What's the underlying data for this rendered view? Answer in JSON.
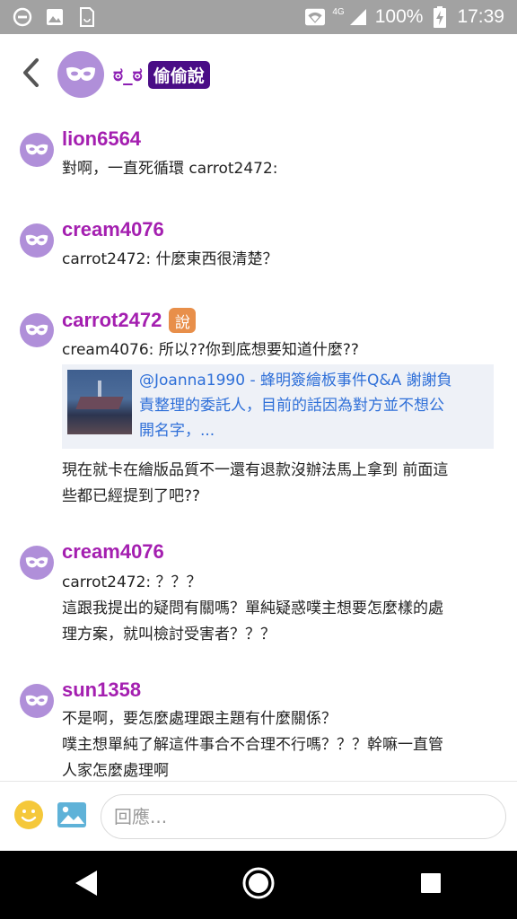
{
  "status_bar": {
    "battery": "100%",
    "time": "17:39",
    "network": "4G",
    "icons": [
      "do-not-disturb-icon",
      "image-icon",
      "sim-icon",
      "wifi-icon",
      "signal-icon",
      "battery-charging-icon"
    ]
  },
  "header": {
    "name": "ಠ_ಠ",
    "badge": "偷偷說"
  },
  "colors": {
    "username": "#a41fb0",
    "avatar": "#b08fd9",
    "header_badge": "#4a0d86",
    "author_badge": "#e88f4a",
    "link": "#2e6fd8"
  },
  "comments": [
    {
      "username": "lion6564",
      "lines": [
        "對啊，一直死循環 carrot2472:"
      ]
    },
    {
      "username": "cream4076",
      "lines": [
        "carrot2472: 什麼東西很清楚？"
      ]
    },
    {
      "username": "carrot2472",
      "author_badge": "說",
      "lines": [
        "cream4076: 所以??你到底想要知道什麼??"
      ],
      "link_card": {
        "lines": [
          "@Joanna1990 - 蜂明簽繪板事件Q&A 謝謝負",
          "責整理的委託人，目前的話因為對方並不想公",
          "開名字，..."
        ]
      },
      "after_lines": [
        "現在就卡在繪版品質不一還有退款沒辦法馬上拿到 前面這",
        "些都已經提到了吧??"
      ]
    },
    {
      "username": "cream4076",
      "lines": [
        "carrot2472: ？？？",
        "這跟我提出的疑問有關嗎？單純疑惑噗主想要怎麼樣的處",
        "理方案，就叫檢討受害者？？？"
      ]
    },
    {
      "username": "sun1358",
      "lines": [
        "不是啊，要怎麼處理跟主題有什麼關係？",
        "噗主想單純了解這件事合不合理不行嗎？？？幹嘛一直管",
        "人家怎麼處理啊"
      ]
    }
  ],
  "input": {
    "placeholder": "回應..."
  }
}
